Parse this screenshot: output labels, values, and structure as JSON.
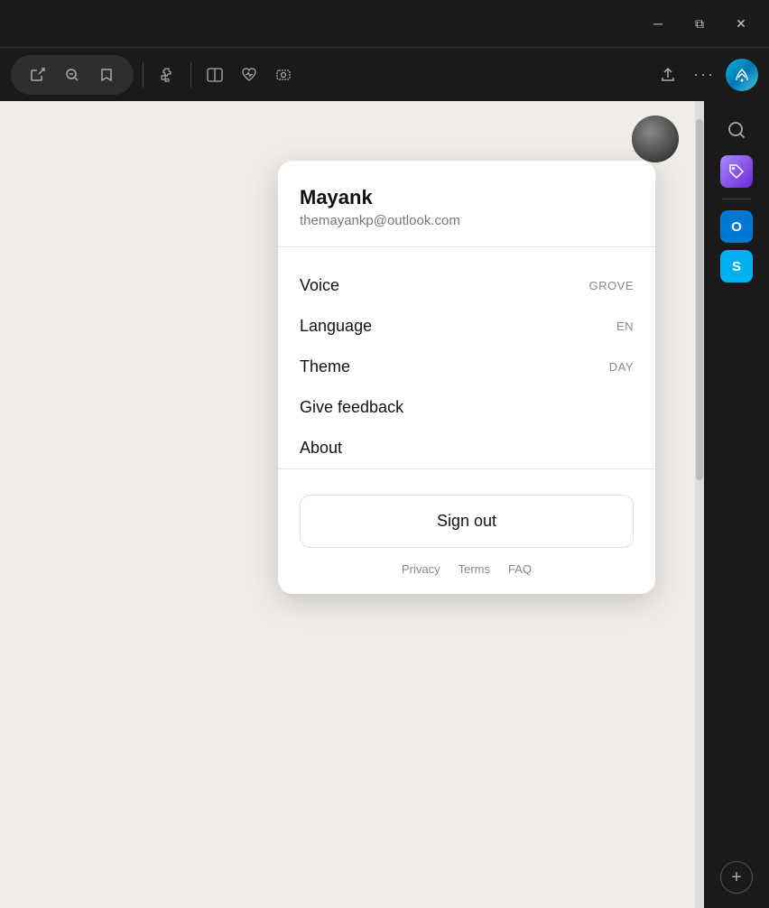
{
  "titlebar": {
    "minimize_label": "─",
    "restore_label": "⧉",
    "close_label": "✕"
  },
  "toolbar": {
    "open_external_icon": "↗",
    "zoom_out_icon": "🔍",
    "bookmark_icon": "☆",
    "puzzle_icon": "🧩",
    "split_icon": "⧉",
    "health_icon": "❤",
    "screenshot_icon": "⬚",
    "share_icon": "⬆",
    "more_icon": "•••"
  },
  "sidebar": {
    "search_icon": "🔍",
    "tag_icon": "🏷",
    "outlook_icon": "O",
    "skype_icon": "S",
    "add_icon": "+"
  },
  "profile": {
    "name": "Mayank",
    "email": "themayankp@outlook.com"
  },
  "menu": {
    "voice_label": "Voice",
    "voice_value": "GROVE",
    "language_label": "Language",
    "language_value": "EN",
    "theme_label": "Theme",
    "theme_value": "DAY",
    "feedback_label": "Give feedback",
    "about_label": "About"
  },
  "sign_out": {
    "label": "Sign out"
  },
  "footer": {
    "privacy_label": "Privacy",
    "terms_label": "Terms",
    "faq_label": "FAQ"
  }
}
